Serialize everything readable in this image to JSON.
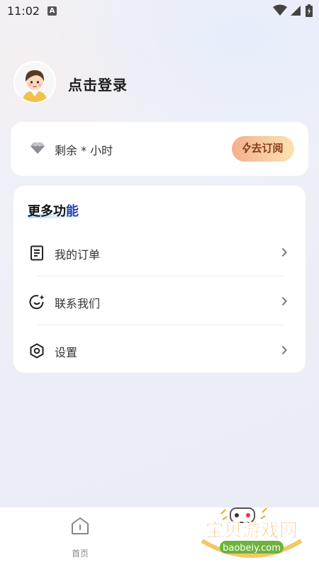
{
  "status_bar": {
    "time": "11:02",
    "indicator": "A",
    "icons": [
      "wifi-icon",
      "signal-icon",
      "battery-icon"
    ]
  },
  "profile": {
    "avatar": "avatar",
    "login_label": "点击登录"
  },
  "subscription": {
    "icon": "diamond-icon",
    "remaining_text": "剩余 * 小时",
    "button_label": "去订阅",
    "button_icon": "lightning-icon"
  },
  "more": {
    "title_part1": "更多功",
    "title_part2": "能",
    "items": [
      {
        "icon": "order-list-icon",
        "label": "我的订单"
      },
      {
        "icon": "contact-chat-icon",
        "label": "联系我们"
      },
      {
        "icon": "settings-hexagon-icon",
        "label": "设置"
      }
    ]
  },
  "bottom_nav": {
    "home_label": "首页"
  },
  "watermark": {
    "brand_text": "宝贝游戏网",
    "domain_text": "baobeiy.com"
  },
  "colors": {
    "accent_blue": "#1f3fb3",
    "subscribe_gradient_start": "#f3b08e",
    "subscribe_gradient_end": "#fbe3b0",
    "watermark_orange": "#f28a1e"
  }
}
